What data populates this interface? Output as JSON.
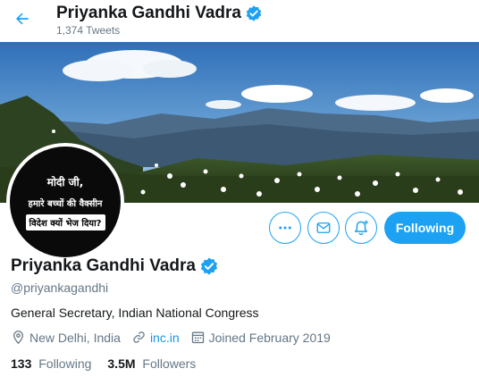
{
  "header": {
    "back_icon": "arrow-left-icon",
    "name": "Priyanka Gandhi Vadra",
    "tweets_count": "1,374 Tweets"
  },
  "banner": {
    "description_icon": "mountain-landscape-photo"
  },
  "avatar": {
    "line1": "मोदी जी,",
    "line2": "हमारे बच्चों की वैक्सीन",
    "line3": "विदेश क्यों भेज दिया?"
  },
  "actions": {
    "more_icon": "more-icon",
    "message_icon": "envelope-icon",
    "notify_icon": "bell-plus-icon",
    "follow_label": "Following"
  },
  "profile": {
    "name": "Priyanka Gandhi Vadra",
    "handle": "@priyankagandhi",
    "bio": "General Secretary, Indian National Congress",
    "location": "New Delhi, India",
    "website": "inc.in",
    "joined": "Joined February 2019"
  },
  "stats": {
    "following_count": "133",
    "following_label": "Following",
    "followers_count": "3.5M",
    "followers_label": "Followers"
  },
  "colors": {
    "accent": "#1da1f2",
    "secondary_text": "#657786"
  }
}
